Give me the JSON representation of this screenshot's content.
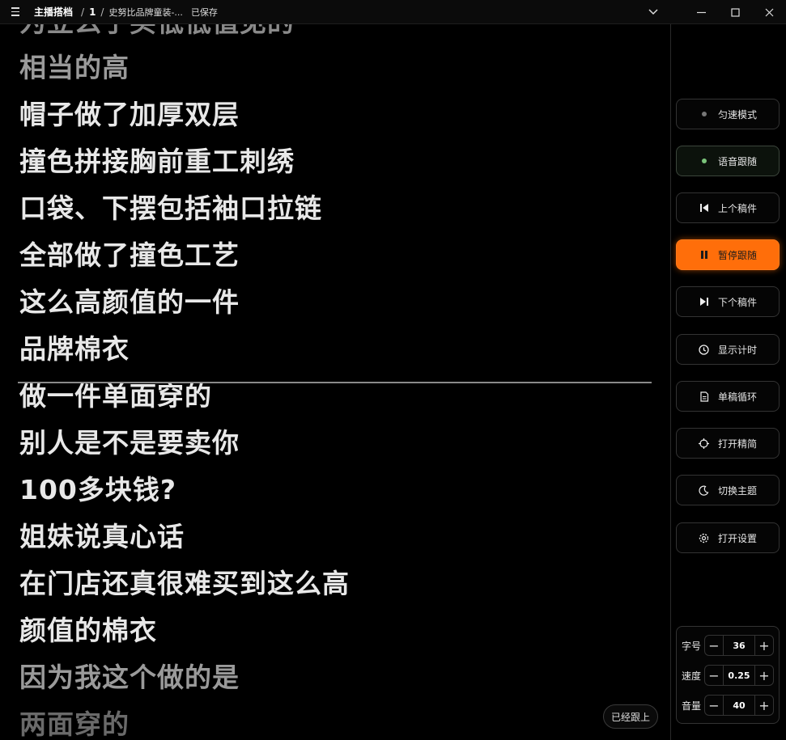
{
  "titlebar": {
    "title": "主播搭档",
    "separator1": "/",
    "number": "1",
    "separator2": "/",
    "document": "史努比品牌童装-...",
    "saved": "已保存"
  },
  "script": {
    "lines": [
      {
        "text": "为立么于买低低值见的",
        "color": "#8a8a8a"
      },
      {
        "text": "相当的高",
        "color": "#9a9a9a"
      },
      {
        "text": "帽子做了加厚双层",
        "color": "#e8e8e8"
      },
      {
        "text": "撞色拼接胸前重工刺绣",
        "color": "#e8e8e8"
      },
      {
        "text": "口袋、下摆包括袖口拉链",
        "color": "#e8e8e8"
      },
      {
        "text": "全部做了撞色工艺",
        "color": "#e8e8e8"
      },
      {
        "text": "这么高颜值的一件",
        "color": "#e8e8e8"
      },
      {
        "text": "品牌棉衣",
        "color": "#e8e8e8"
      },
      {
        "text": "做一件单面穿的",
        "color": "#e8e8e8"
      },
      {
        "text": "别人是不是要卖你",
        "color": "#e8e8e8"
      },
      {
        "text": "100多块钱?",
        "color": "#e8e8e8"
      },
      {
        "text": "姐妹说真心话",
        "color": "#e8e8e8"
      },
      {
        "text": "在门店还真很难买到这么高",
        "color": "#e8e8e8"
      },
      {
        "text": "颜值的棉衣",
        "color": "#e8e8e8"
      },
      {
        "text": "因为我这个做的是",
        "color": "#9a9a9a"
      },
      {
        "text": "两面穿的",
        "color": "#6a6a6a"
      }
    ],
    "status_chip": "已经跟上"
  },
  "sidebar": {
    "buttons": [
      {
        "label": "匀速模式",
        "icon": "dot-gray-icon"
      },
      {
        "label": "语音跟随",
        "icon": "dot-green-icon"
      },
      {
        "label": "上个稿件",
        "icon": "skip-back-icon"
      },
      {
        "label": "暂停跟随",
        "icon": "pause-icon"
      },
      {
        "label": "下个稿件",
        "icon": "skip-forward-icon"
      },
      {
        "label": "显示计时",
        "icon": "clock-icon"
      },
      {
        "label": "单稿循环",
        "icon": "document-icon"
      },
      {
        "label": "打开精简",
        "icon": "crosshair-icon"
      },
      {
        "label": "切换主题",
        "icon": "moon-icon"
      },
      {
        "label": "打开设置",
        "icon": "gear-icon"
      }
    ],
    "controls": [
      {
        "label": "字号",
        "value": "36"
      },
      {
        "label": "速度",
        "value": "0.25"
      },
      {
        "label": "音量",
        "value": "40"
      }
    ]
  },
  "colors": {
    "accent": "#ff6e0a",
    "voice_dot": "#7bc47b",
    "uniform_dot": "#777777"
  }
}
